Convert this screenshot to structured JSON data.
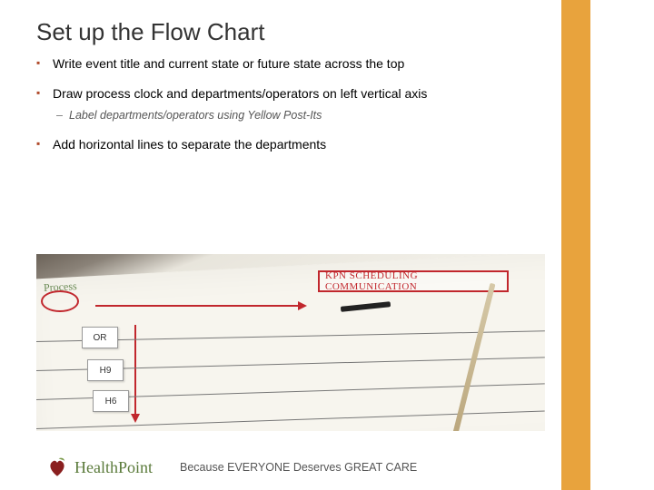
{
  "title": "Set up the Flow Chart",
  "bullets": [
    {
      "text": "Write event title and current state or future state across the top"
    },
    {
      "text": "Draw process clock and departments/operators on left vertical axis",
      "sub": [
        "Label departments/operators using Yellow Post-Its"
      ]
    },
    {
      "text": "Add horizontal lines to separate the departments"
    }
  ],
  "photo": {
    "process_label": "Process",
    "red_box_text": "KPN   SCHEDULING  COMMUNICATION",
    "postits": [
      "OR",
      "H9",
      "H6"
    ]
  },
  "footer": {
    "brand_part1": "Health",
    "brand_part2": "Point",
    "tagline": "Because EVERYONE Deserves GREAT CARE"
  },
  "colors": {
    "accent": "#e8a33d",
    "bullet": "#b04a2a",
    "red": "#c1272d",
    "green": "#5a7a3a"
  }
}
